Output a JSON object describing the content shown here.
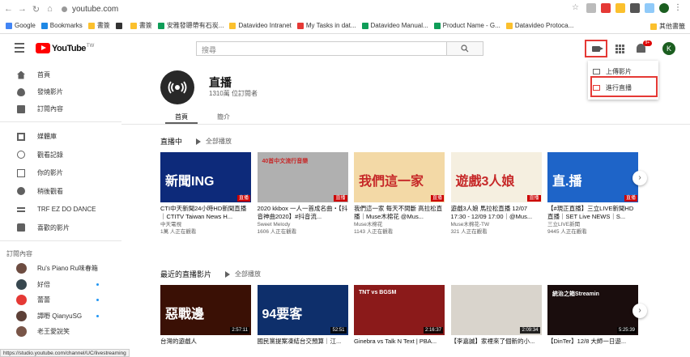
{
  "browser": {
    "url": "youtube.com",
    "bookmarks": [
      {
        "label": "Google",
        "color": "#4285f4"
      },
      {
        "label": "Bookmarks",
        "color": "#1e88e5"
      },
      {
        "label": "書簽",
        "color": "#fbc02d"
      },
      {
        "label": "",
        "color": "#333333"
      },
      {
        "label": "書簽",
        "color": "#fbc02d"
      },
      {
        "label": "安雅發聰帶有石炭...",
        "color": "#0f9d58"
      },
      {
        "label": "Datavideo Intranet",
        "color": "#fbc02d"
      },
      {
        "label": "My Tasks in dat...",
        "color": "#e53935"
      },
      {
        "label": "Datavideo Manual...",
        "color": "#0f9d58"
      },
      {
        "label": "Product Name - G...",
        "color": "#0f9d58"
      },
      {
        "label": "Datavideo Protoca...",
        "color": "#fbc02d"
      }
    ],
    "other_bookmarks": "其他書籤",
    "status_url": "https://studio.youtube.com/channel/UC/livestreaming"
  },
  "header": {
    "logo_text": "YouTube",
    "region": "TW",
    "search_placeholder": "搜尋",
    "notification_count": "9+",
    "avatar_letter": "K"
  },
  "create_menu": {
    "upload": "上傳影片",
    "go_live": "進行直播"
  },
  "sidebar": {
    "main": [
      {
        "label": "首頁",
        "icon": "home-icon"
      },
      {
        "label": "發燒影片",
        "icon": "trending-icon"
      },
      {
        "label": "訂閱內容",
        "icon": "subscriptions-icon"
      }
    ],
    "library": [
      {
        "label": "媒體庫",
        "icon": "library-icon"
      },
      {
        "label": "觀看記錄",
        "icon": "history-icon"
      },
      {
        "label": "你的影片",
        "icon": "your-videos-icon"
      },
      {
        "label": "稍後觀看",
        "icon": "watch-later-icon"
      },
      {
        "label": "TRF EZ DO DANCE",
        "icon": "playlist-icon"
      },
      {
        "label": "喜歡的影片",
        "icon": "liked-icon"
      }
    ],
    "subs_heading": "訂閱內容",
    "subscriptions": [
      {
        "label": "Ru's Piano Ru味春箱",
        "color": "#6d4c41"
      },
      {
        "label": "好倍",
        "color": "#37474f"
      },
      {
        "label": "蕾蕾",
        "color": "#e53935"
      },
      {
        "label": "譚嘢 QianyuSG",
        "color": "#5d4037"
      },
      {
        "label": "老王愛說笑",
        "color": "#795548"
      }
    ]
  },
  "channel": {
    "name": "直播",
    "subscribers": "1310萬 位訂閱者",
    "tabs": [
      "首頁",
      "簡介"
    ]
  },
  "sections": [
    {
      "title": "直播中",
      "play_all": "全部播放",
      "videos": [
        {
          "title": "CTI中天新聞24小時HD新聞直播｜CTITV Taiwan News H...",
          "channel": "中天電視",
          "meta": "1萬 人正在觀看",
          "badge": "直播",
          "thumb_text": "新聞ING",
          "bg": "#0d2a7a"
        },
        {
          "title": "2020 kkbox 一人一首成名曲・【抖音神曲2020】#抖音流...",
          "channel": "Sweet Melody",
          "meta": "1606 人正在觀看",
          "badge": "直播",
          "thumb_text": "40首中文流行音樂",
          "bg": "#b0b0b0"
        },
        {
          "title": "我們這一家 每天不間斷 高拉松直播｜Muse木棉花 @Mus...",
          "channel": "Muse木棉花",
          "meta": "1143 人正在觀看",
          "badge": "直播",
          "thumb_text": "我們這一家",
          "bg": "#f3d9a6"
        },
        {
          "title": "遊戲3人娘 馬拉松直播 12/07 17:30 - 12/09 17:00｜@Mus...",
          "channel": "Muse木棉花-TW",
          "meta": "321 人正在觀看",
          "badge": "直播",
          "thumb_text": "遊戲3人娘",
          "bg": "#f5efe0"
        },
        {
          "title": "【#現正直播】三立LIVE新聞HD直播｜SET Live NEWS｜S...",
          "channel": "三立LIVE新聞",
          "meta": "9445 人正在觀看",
          "badge": "直播",
          "thumb_text": "直.播",
          "bg": "#1e64c8"
        }
      ]
    },
    {
      "title": "最近的直播影片",
      "play_all": "全部播放",
      "videos": [
        {
          "title": "台灣的遊戲人",
          "duration": "2:57:11",
          "thumb_text": "惡戰邊",
          "bg": "#3a1005"
        },
        {
          "title": "國民黨提案凍結台交預算｜江...",
          "duration": "52:51",
          "thumb_text": "94要客",
          "bg": "#0e2f6b"
        },
        {
          "title": "Ginebra vs Talk N Text | PBA...",
          "duration": "2:16:37",
          "thumb_text": "TNT vs BGSM",
          "bg": "#8b1a1a"
        },
        {
          "title": "【李嘉誠】家裡來了個新的小...",
          "duration": "2:09:34",
          "thumb_text": "",
          "bg": "#d9d4cc"
        },
        {
          "title": "【DinTer】12/8 大師一日遊...",
          "duration": "5:25:39",
          "thumb_text": "統治之箱Streamin",
          "bg": "#1a0d0d"
        }
      ]
    }
  ]
}
